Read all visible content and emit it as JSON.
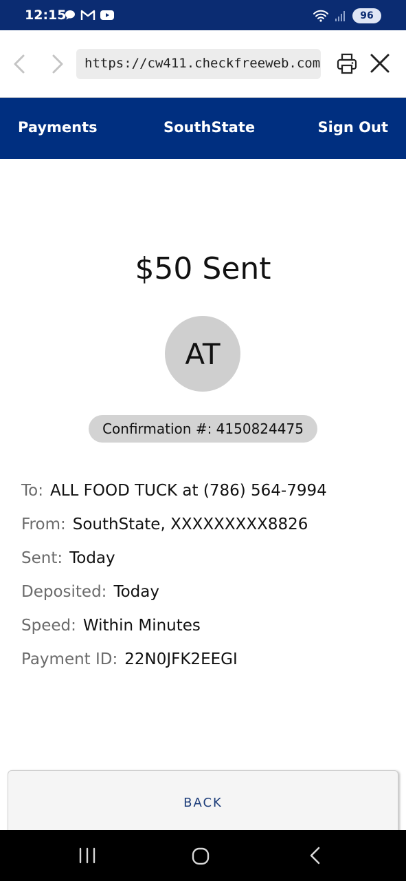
{
  "status_bar": {
    "time": "12:15",
    "battery": "96",
    "left_icons": [
      "chat-icon",
      "gmail-icon",
      "youtube-icon"
    ],
    "right_icons": [
      "wifi-icon",
      "signal-icon",
      "battery-icon"
    ]
  },
  "browser": {
    "url": "https://cw411.checkfreeweb.com/..."
  },
  "nav": {
    "payments": "Payments",
    "bank": "SouthState",
    "sign_out": "Sign Out"
  },
  "payment": {
    "title": "$50 Sent",
    "avatar_initials": "AT",
    "confirmation": "Confirmation #: 4150824475"
  },
  "details": [
    {
      "label": "To:",
      "value": "ALL FOOD TUCK at (786) 564-7994"
    },
    {
      "label": "From:",
      "value": "SouthState, XXXXXXXXX8826"
    },
    {
      "label": "Sent:",
      "value": "Today"
    },
    {
      "label": "Deposited:",
      "value": "Today"
    },
    {
      "label": "Speed:",
      "value": "Within Minutes"
    },
    {
      "label": "Payment ID:",
      "value": "22N0JFK2EEGI"
    }
  ],
  "actions": {
    "back": "BACK"
  },
  "colors": {
    "brand_navy": "#002f80",
    "status_bar": "#0b2c72",
    "avatar_bg": "#cfcfcf",
    "label_gray": "#6b6b6b"
  }
}
